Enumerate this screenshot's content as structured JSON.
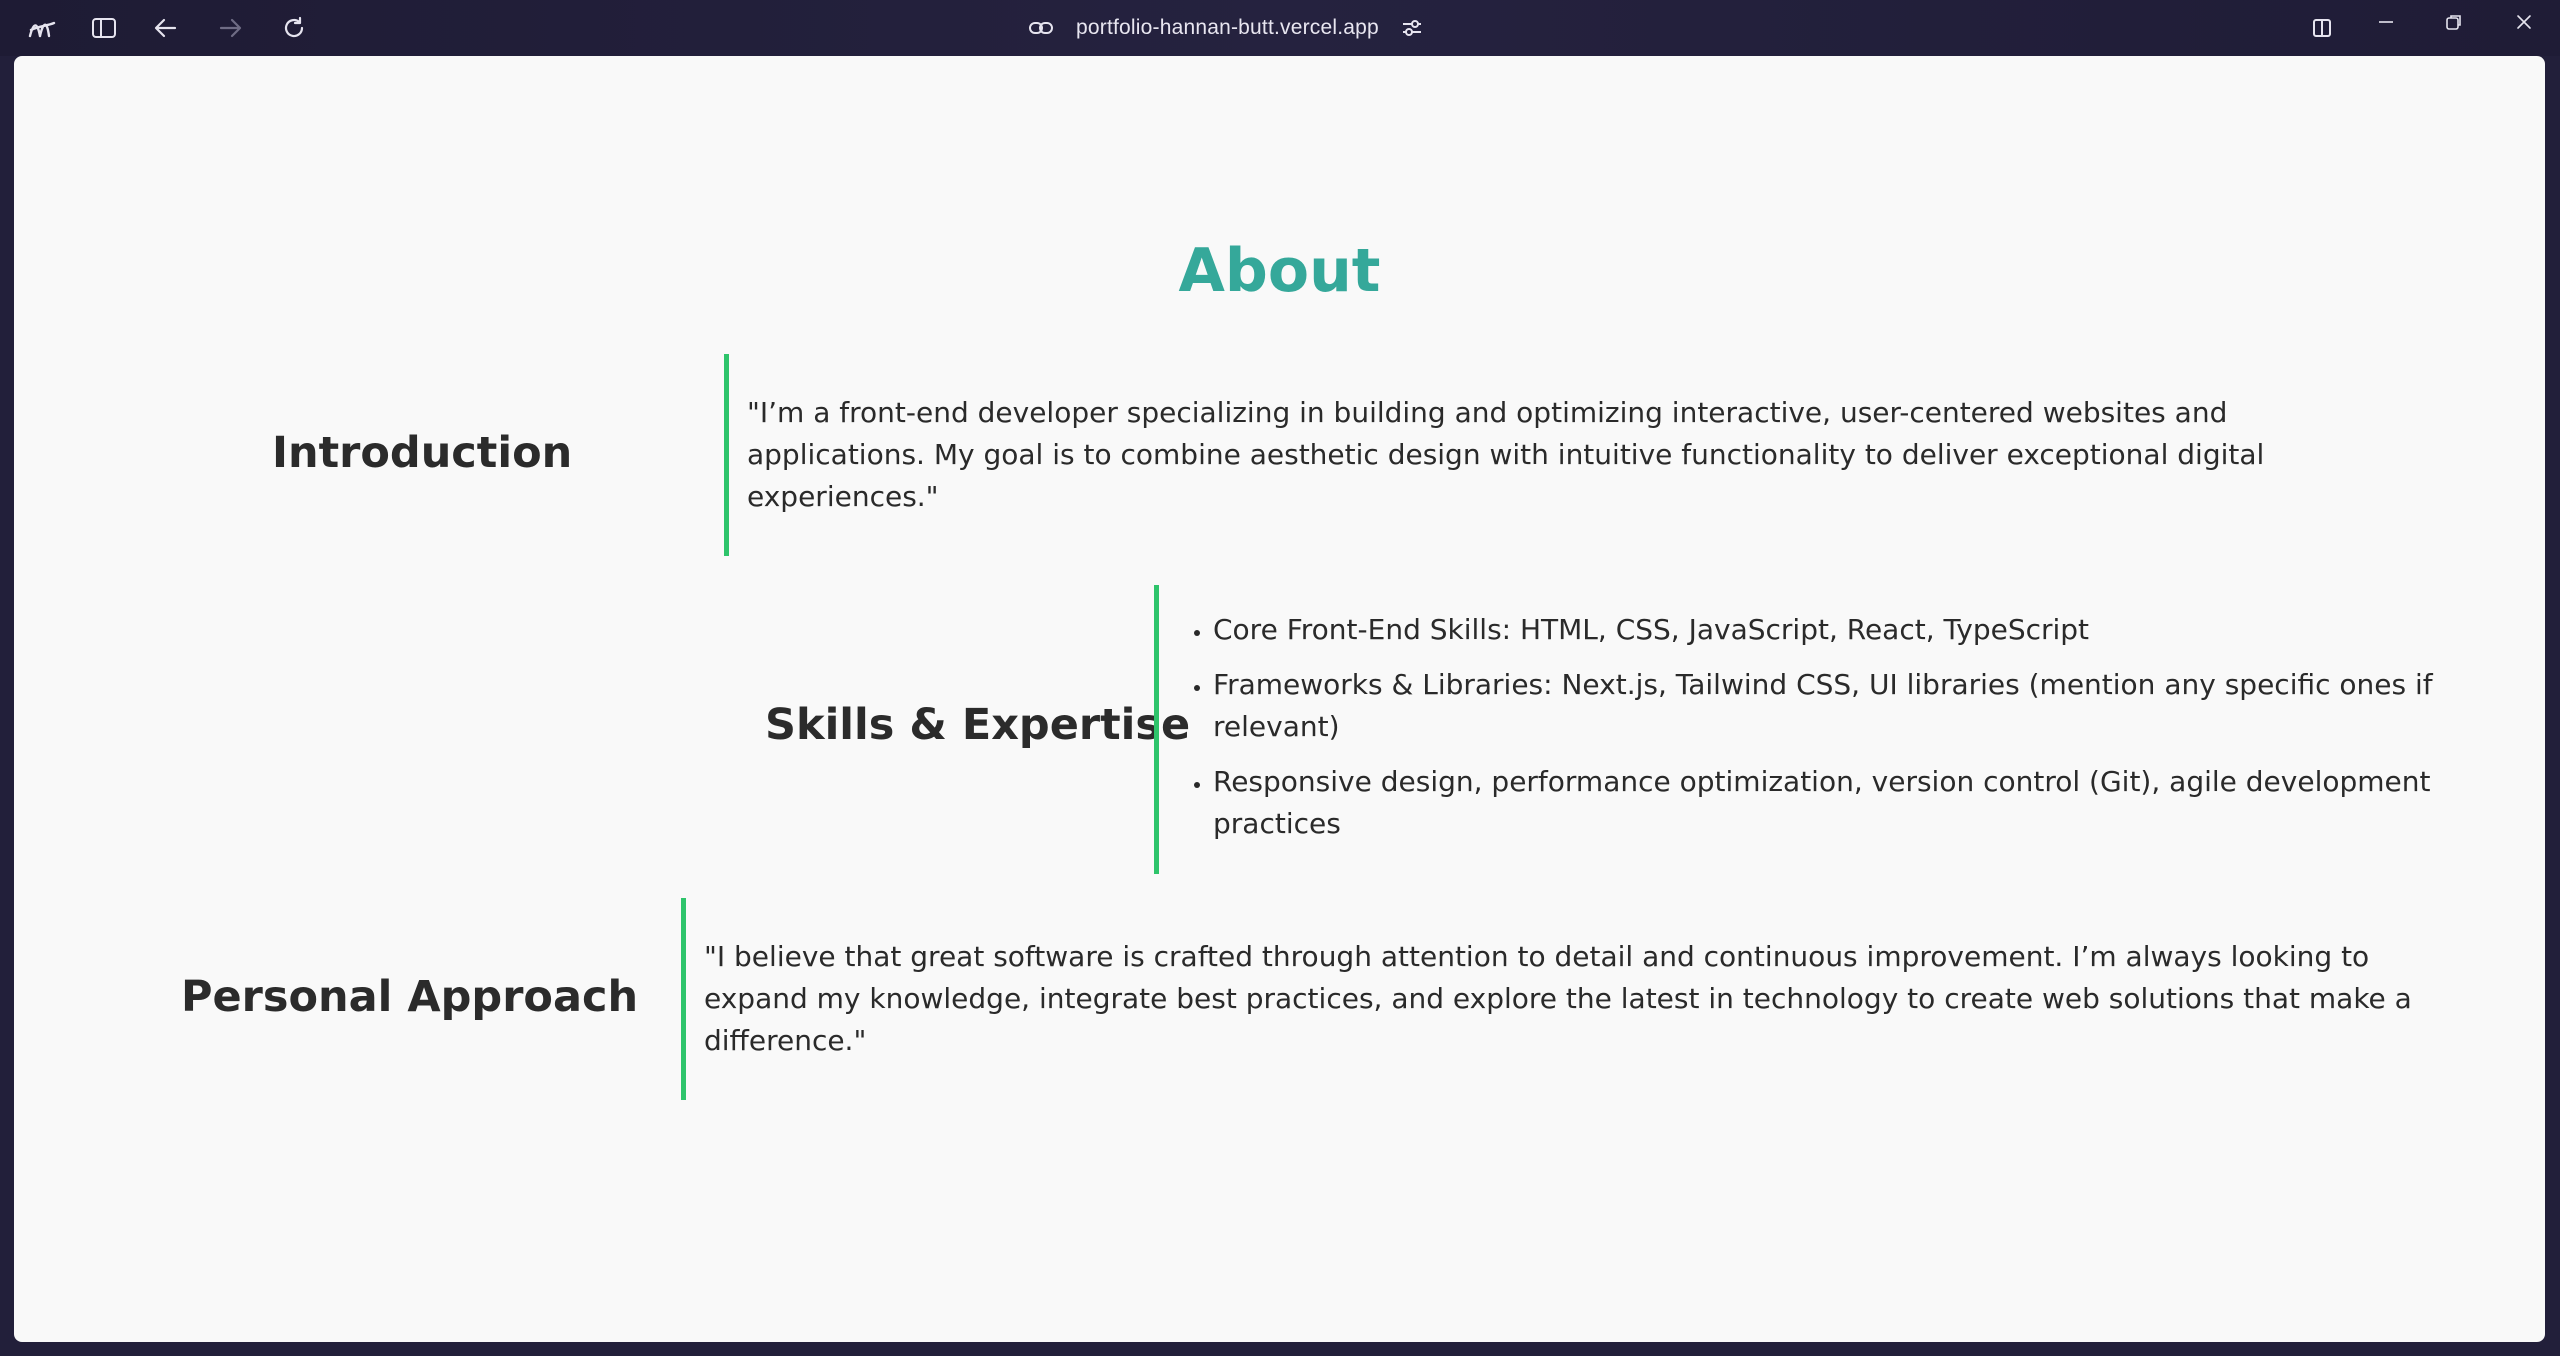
{
  "browser": {
    "url": "portfolio-hannan-butt.vercel.app",
    "icons": [
      "arc-logo-icon",
      "sidebar-toggle-icon",
      "back-arrow-icon",
      "forward-arrow-icon",
      "reload-icon",
      "link-icon",
      "site-settings-icon",
      "split-view-icon",
      "minimize-icon",
      "restore-icon",
      "close-icon"
    ]
  },
  "page": {
    "title": "About",
    "title_color": "#35a89a",
    "accent_color": "#2ec46b",
    "sections": {
      "introduction": {
        "heading": "Introduction",
        "text": "\"I’m a front-end developer specializing in building and optimizing interactive, user-centered websites and applications. My goal is to combine aesthetic design with intuitive functionality to deliver exceptional digital experiences.\""
      },
      "skills": {
        "heading": "Skills & Expertise",
        "items": [
          "Core Front-End Skills: HTML, CSS, JavaScript, React, TypeScript",
          "Frameworks & Libraries: Next.js, Tailwind CSS, UI libraries (mention any specific ones if relevant)",
          "Responsive design, performance optimization, version control (Git), agile development practices"
        ]
      },
      "approach": {
        "heading": "Personal Approach",
        "text": "\"I believe that great software is crafted through attention to detail and continuous improvement. I’m always looking to expand my knowledge, integrate best practices, and explore the latest in technology to create web solutions that make a difference.\""
      }
    }
  }
}
